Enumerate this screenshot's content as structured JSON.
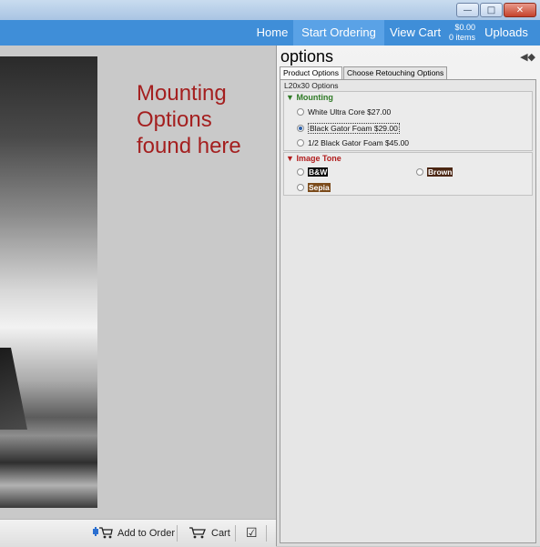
{
  "window": {
    "min_icon": "minimize-icon",
    "max_icon": "maximize-icon",
    "close_icon": "close-icon"
  },
  "nav": {
    "home": "Home",
    "start_ordering": "Start Ordering",
    "view_cart": "View Cart",
    "total": "$0.00",
    "items": "0 items",
    "uploads": "Uploads",
    "accent": "#3f8ed8"
  },
  "main": {
    "mount_text_1": "Mounting",
    "mount_text_2": "Options",
    "mount_text_3": "found here"
  },
  "toolbar": {
    "add_to_order": "Add to Order",
    "cart": "Cart"
  },
  "panel": {
    "title": "options",
    "tabs": [
      {
        "label": "Product Options"
      },
      {
        "label": "Choose Retouching Options"
      }
    ],
    "size_label": "L20x30 Options",
    "mounting": {
      "header": "Mounting",
      "options": [
        {
          "label": "White Ultra Core $27.00",
          "selected": false
        },
        {
          "label": "Black Gator Foam $29.00",
          "selected": true
        },
        {
          "label": "1/2  Black Gator Foam $45.00",
          "selected": false
        }
      ]
    },
    "tone": {
      "header": "Image Tone",
      "options": [
        {
          "label": "B&W"
        },
        {
          "label": "Brown"
        },
        {
          "label": "Sepia"
        }
      ]
    }
  }
}
